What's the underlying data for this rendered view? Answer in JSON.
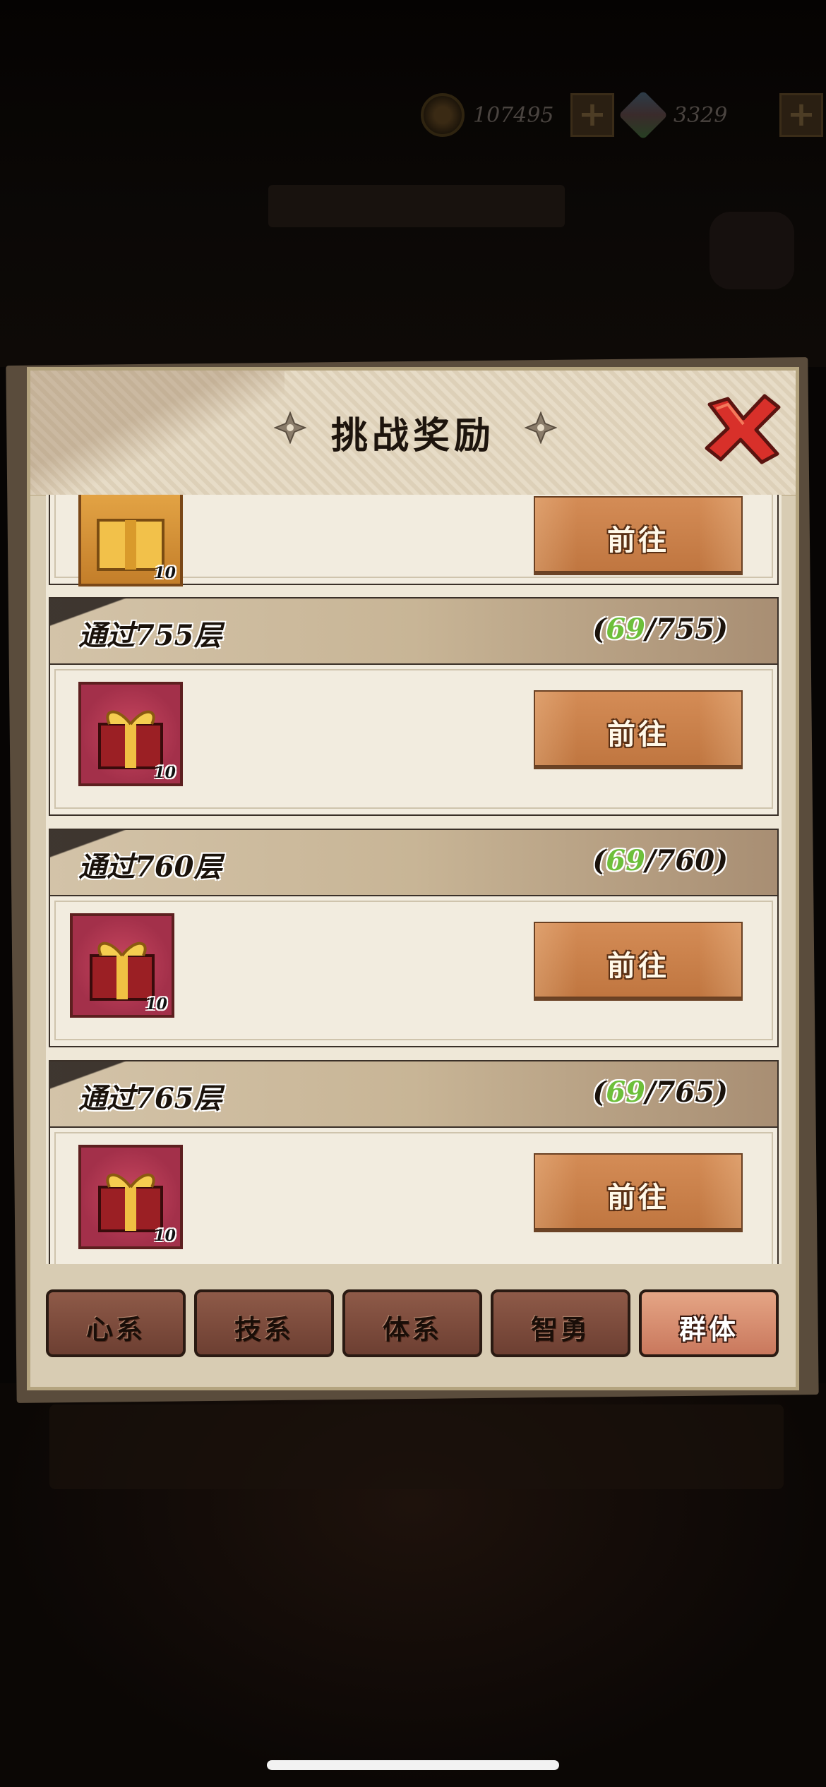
{
  "topbar": {
    "coins": "107495",
    "gems": "3329"
  },
  "dialog": {
    "title": "挑战奖励",
    "close_label": "×"
  },
  "rewards": [
    {
      "header": "",
      "progress_current": "",
      "progress_total": "",
      "item_count": "10",
      "button_label": "前往"
    },
    {
      "header": "通过755层",
      "progress_current": "69",
      "progress_total": "/755",
      "item_count": "10",
      "button_label": "前往"
    },
    {
      "header": "通过760层",
      "progress_current": "69",
      "progress_total": "/760",
      "item_count": "10",
      "button_label": "前往"
    },
    {
      "header": "通过765层",
      "progress_current": "69",
      "progress_total": "/765",
      "item_count": "10",
      "button_label": "前往"
    }
  ],
  "tabs": [
    {
      "label": "心系",
      "active": false
    },
    {
      "label": "技系",
      "active": false
    },
    {
      "label": "体系",
      "active": false
    },
    {
      "label": "智勇",
      "active": false
    },
    {
      "label": "群体",
      "active": true
    }
  ],
  "colors": {
    "progress_highlight": "#6dbf3a",
    "tab_active": "#c9785d",
    "tab_inactive": "#6d3f32",
    "button": "#c07640"
  }
}
